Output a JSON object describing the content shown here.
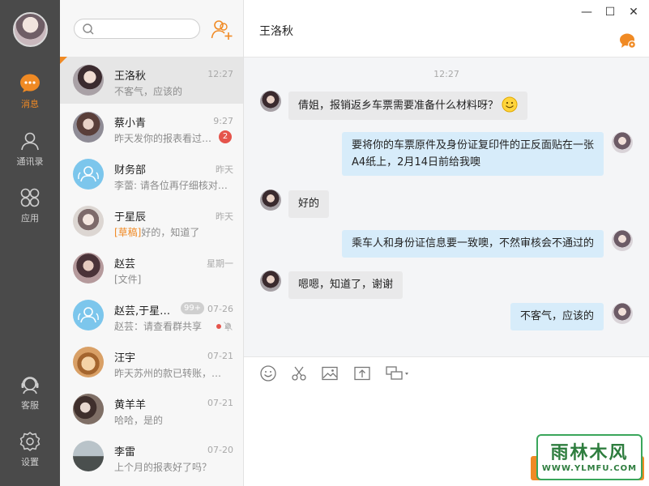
{
  "colors": {
    "accent": "#f08a24",
    "nav_bg": "#4a4a4a",
    "badge_red": "#e5544b",
    "bubble_out": "#d7ecfa",
    "bubble_in": "#e9e9ea"
  },
  "nav": {
    "items": [
      {
        "label": "消息",
        "icon": "message-icon",
        "active": true
      },
      {
        "label": "通讯录",
        "icon": "contacts-icon",
        "active": false
      },
      {
        "label": "应用",
        "icon": "apps-icon",
        "active": false
      },
      {
        "label": "客服",
        "icon": "customer-service-icon",
        "active": false
      },
      {
        "label": "设置",
        "icon": "settings-icon",
        "active": false
      }
    ]
  },
  "search": {
    "placeholder": ""
  },
  "conversations": [
    {
      "name": "王洛秋",
      "time": "12:27",
      "preview": "不客气，应该的",
      "selected": true
    },
    {
      "name": "蔡小青",
      "time": "9:27",
      "preview": "昨天发你的报表看过了吗",
      "unread": "2"
    },
    {
      "name": "财务部",
      "time": "昨天",
      "preview": "李蕾: 请各位再仔细核对一下"
    },
    {
      "name": "于星辰",
      "time": "昨天",
      "draft_tag": "[草稿]",
      "preview": "好的，知道了"
    },
    {
      "name": "赵芸",
      "time": "星期一",
      "preview": "[文件]"
    },
    {
      "name": "赵芸,于星辰,李蕾",
      "count": "99+",
      "time": "07-26",
      "preview": "赵芸：请查看群共享"
    },
    {
      "name": "汪宇",
      "time": "07-21",
      "preview": "昨天苏州的款已转账，请查收"
    },
    {
      "name": "黄羊羊",
      "time": "07-21",
      "preview": "哈哈，是的"
    },
    {
      "name": "李雷",
      "time": "07-20",
      "preview": "上个月的报表好了吗？"
    }
  ],
  "chat": {
    "title": "王洛秋",
    "time_divider": "12:27",
    "messages": [
      {
        "direction": "in",
        "text": "倩姐，报销返乡车票需要准备什么材料呀？"
      },
      {
        "direction": "out",
        "lines": [
          "要将你的车票原件及身份证复印件的正反面贴在一张",
          "A4纸上，2月14日前给我噢"
        ]
      },
      {
        "direction": "in",
        "text": "好的"
      },
      {
        "direction": "out",
        "text": "乘车人和身份证信息要一致噢，不然审核会不通过的"
      },
      {
        "direction": "in",
        "text": "嗯嗯，知道了，谢谢"
      },
      {
        "direction": "out",
        "text": "不客气，应该的"
      }
    ]
  },
  "composer": {
    "tools": [
      "emoji-icon",
      "screenshot-scissors-icon",
      "image-icon",
      "upload-file-icon",
      "remote-screen-icon"
    ],
    "input_value": ""
  },
  "window": {
    "minimize": "—",
    "maximize": "☐",
    "close": "✕"
  },
  "watermark": {
    "title": "雨林木风",
    "url": "WWW.YLMFU.COM"
  }
}
